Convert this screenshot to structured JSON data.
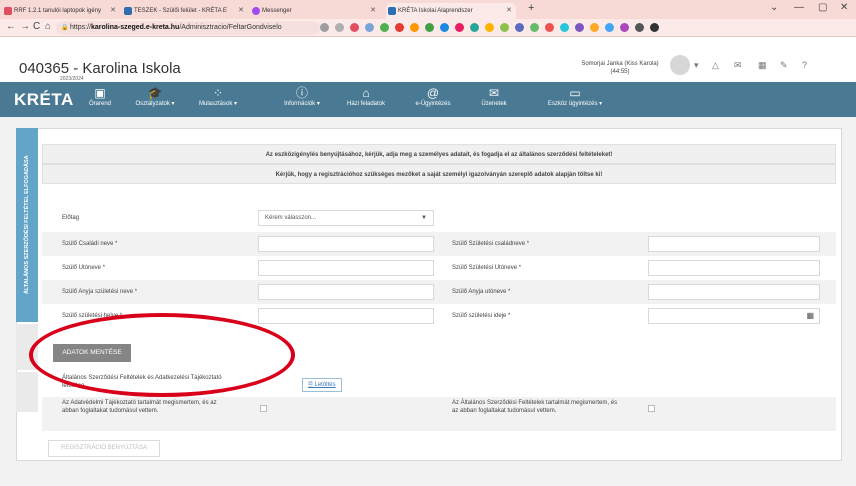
{
  "browser": {
    "tabs": [
      {
        "title": "RRF 1.2.1 tanulói laptopok igény",
        "icon_color": "#e04f5f"
      },
      {
        "title": "TESZEK - Szülői felület - KRÉTA E",
        "icon_color": "#2c6fb3"
      },
      {
        "title": "Messenger",
        "icon_color": "#a14df0"
      },
      {
        "title": "KRÉTA Iskolai Alaprendszer",
        "icon_color": "#2c6fb3"
      }
    ],
    "url_prefix": "https://",
    "url_host": "karolina-szeged.e-kreta.hu",
    "url_path": "/Adminisztracio/FeltarGondviselo",
    "new_tab": "+"
  },
  "header": {
    "school": "040365 - Karolina Iskola",
    "year": "2023/2024",
    "user": "Somorjai Janka (Kiss Karola)",
    "timer": "(44:55)"
  },
  "nav": {
    "logo": "KRÉTA",
    "items": [
      {
        "label": "Órarend",
        "icon": "calendar-icon"
      },
      {
        "label": "Osztályzatok ▾",
        "icon": "graduation-cap-icon"
      },
      {
        "label": "Mulasztások ▾",
        "icon": "spinner-icon"
      },
      {
        "label": "Információk ▾",
        "icon": "info-icon"
      },
      {
        "label": "Házi feladatok",
        "icon": "home-icon"
      },
      {
        "label": "e-Ügyintézés",
        "icon": "at-icon"
      },
      {
        "label": "Üzenetek",
        "icon": "envelope-icon"
      },
      {
        "label": "Eszköz ügyintézés ▾",
        "icon": "laptop-icon"
      }
    ],
    "bg_color": "#4a7a93"
  },
  "sidetab": {
    "label": "ÁLTALÁNOS SZERZŐDÉSI FELTÉTEL ELFOGADÁSA",
    "color": "#63a5c8"
  },
  "info": {
    "line1": "Az eszközigénylés benyújtásához, kérjük, adja meg a személyes adatait, és fogadja el az általános szerződési feltételeket!",
    "line2": "Kérjük, hogy a regisztrációhoz szükséges mezőket a saját személyi igazolványán szereplő adatok alapján töltse ki!"
  },
  "form": {
    "prefix_label": "Előtag",
    "prefix_placeholder": "Kérem válasszon...",
    "rows": [
      {
        "left": "Szülő Családi neve *",
        "right": "Szülő Születési családneve *"
      },
      {
        "left": "Szülő Utóneve *",
        "right": "Szülő Születési Utóneve *"
      },
      {
        "left": "Szülő Anyja születési neve *",
        "right": "Szülő Anyja utóneve *"
      },
      {
        "left": "Szülő születési helye *",
        "right": "Szülő születési ideje *"
      }
    ]
  },
  "actions": {
    "save": "ADATOK MENTÉSE",
    "terms_label": "Általános Szerződési Feltételek és Adatkezelési Tájékoztató letöltése",
    "download": "Letöltés",
    "privacy_accept": "Az Adatvédelmi Tájékoztató tartalmát megismertem, és az abban foglaltakat tudomásul vettem.",
    "terms_accept": "Az Általános Szerződési Feltételek tartalmát megismertem, és az abban foglaltakat tudomásul vettem.",
    "submit": "REGISZTRÁCIÓ BENYÚJTÁSA"
  },
  "annotation_color": "#d9001a"
}
